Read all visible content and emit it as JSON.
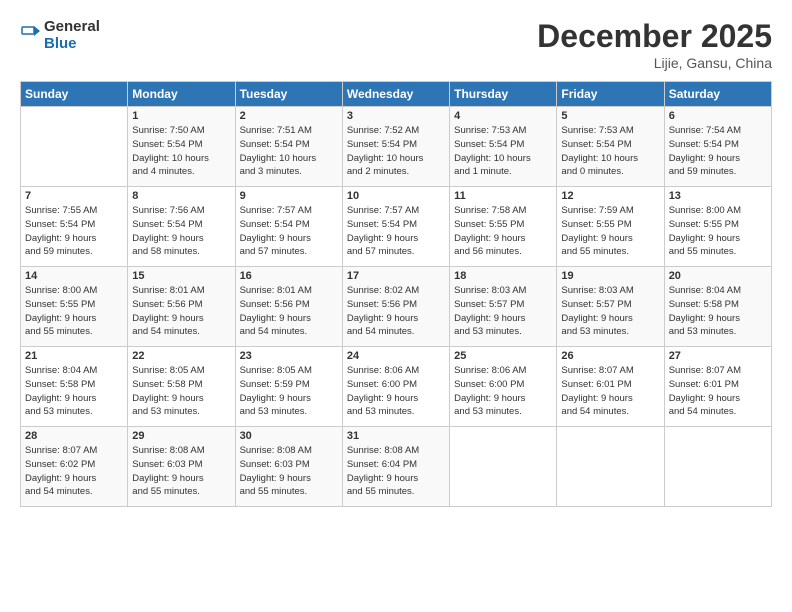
{
  "header": {
    "logo_line1": "General",
    "logo_line2": "Blue",
    "month": "December 2025",
    "location": "Lijie, Gansu, China"
  },
  "weekdays": [
    "Sunday",
    "Monday",
    "Tuesday",
    "Wednesday",
    "Thursday",
    "Friday",
    "Saturday"
  ],
  "weeks": [
    [
      {
        "day": "",
        "sunrise": "",
        "sunset": "",
        "daylight": ""
      },
      {
        "day": "1",
        "sunrise": "Sunrise: 7:50 AM",
        "sunset": "Sunset: 5:54 PM",
        "daylight": "Daylight: 10 hours and 4 minutes."
      },
      {
        "day": "2",
        "sunrise": "Sunrise: 7:51 AM",
        "sunset": "Sunset: 5:54 PM",
        "daylight": "Daylight: 10 hours and 3 minutes."
      },
      {
        "day": "3",
        "sunrise": "Sunrise: 7:52 AM",
        "sunset": "Sunset: 5:54 PM",
        "daylight": "Daylight: 10 hours and 2 minutes."
      },
      {
        "day": "4",
        "sunrise": "Sunrise: 7:53 AM",
        "sunset": "Sunset: 5:54 PM",
        "daylight": "Daylight: 10 hours and 1 minute."
      },
      {
        "day": "5",
        "sunrise": "Sunrise: 7:53 AM",
        "sunset": "Sunset: 5:54 PM",
        "daylight": "Daylight: 10 hours and 0 minutes."
      },
      {
        "day": "6",
        "sunrise": "Sunrise: 7:54 AM",
        "sunset": "Sunset: 5:54 PM",
        "daylight": "Daylight: 9 hours and 59 minutes."
      }
    ],
    [
      {
        "day": "7",
        "sunrise": "Sunrise: 7:55 AM",
        "sunset": "Sunset: 5:54 PM",
        "daylight": "Daylight: 9 hours and 59 minutes."
      },
      {
        "day": "8",
        "sunrise": "Sunrise: 7:56 AM",
        "sunset": "Sunset: 5:54 PM",
        "daylight": "Daylight: 9 hours and 58 minutes."
      },
      {
        "day": "9",
        "sunrise": "Sunrise: 7:57 AM",
        "sunset": "Sunset: 5:54 PM",
        "daylight": "Daylight: 9 hours and 57 minutes."
      },
      {
        "day": "10",
        "sunrise": "Sunrise: 7:57 AM",
        "sunset": "Sunset: 5:54 PM",
        "daylight": "Daylight: 9 hours and 57 minutes."
      },
      {
        "day": "11",
        "sunrise": "Sunrise: 7:58 AM",
        "sunset": "Sunset: 5:55 PM",
        "daylight": "Daylight: 9 hours and 56 minutes."
      },
      {
        "day": "12",
        "sunrise": "Sunrise: 7:59 AM",
        "sunset": "Sunset: 5:55 PM",
        "daylight": "Daylight: 9 hours and 55 minutes."
      },
      {
        "day": "13",
        "sunrise": "Sunrise: 8:00 AM",
        "sunset": "Sunset: 5:55 PM",
        "daylight": "Daylight: 9 hours and 55 minutes."
      }
    ],
    [
      {
        "day": "14",
        "sunrise": "Sunrise: 8:00 AM",
        "sunset": "Sunset: 5:55 PM",
        "daylight": "Daylight: 9 hours and 55 minutes."
      },
      {
        "day": "15",
        "sunrise": "Sunrise: 8:01 AM",
        "sunset": "Sunset: 5:56 PM",
        "daylight": "Daylight: 9 hours and 54 minutes."
      },
      {
        "day": "16",
        "sunrise": "Sunrise: 8:01 AM",
        "sunset": "Sunset: 5:56 PM",
        "daylight": "Daylight: 9 hours and 54 minutes."
      },
      {
        "day": "17",
        "sunrise": "Sunrise: 8:02 AM",
        "sunset": "Sunset: 5:56 PM",
        "daylight": "Daylight: 9 hours and 54 minutes."
      },
      {
        "day": "18",
        "sunrise": "Sunrise: 8:03 AM",
        "sunset": "Sunset: 5:57 PM",
        "daylight": "Daylight: 9 hours and 53 minutes."
      },
      {
        "day": "19",
        "sunrise": "Sunrise: 8:03 AM",
        "sunset": "Sunset: 5:57 PM",
        "daylight": "Daylight: 9 hours and 53 minutes."
      },
      {
        "day": "20",
        "sunrise": "Sunrise: 8:04 AM",
        "sunset": "Sunset: 5:58 PM",
        "daylight": "Daylight: 9 hours and 53 minutes."
      }
    ],
    [
      {
        "day": "21",
        "sunrise": "Sunrise: 8:04 AM",
        "sunset": "Sunset: 5:58 PM",
        "daylight": "Daylight: 9 hours and 53 minutes."
      },
      {
        "day": "22",
        "sunrise": "Sunrise: 8:05 AM",
        "sunset": "Sunset: 5:58 PM",
        "daylight": "Daylight: 9 hours and 53 minutes."
      },
      {
        "day": "23",
        "sunrise": "Sunrise: 8:05 AM",
        "sunset": "Sunset: 5:59 PM",
        "daylight": "Daylight: 9 hours and 53 minutes."
      },
      {
        "day": "24",
        "sunrise": "Sunrise: 8:06 AM",
        "sunset": "Sunset: 6:00 PM",
        "daylight": "Daylight: 9 hours and 53 minutes."
      },
      {
        "day": "25",
        "sunrise": "Sunrise: 8:06 AM",
        "sunset": "Sunset: 6:00 PM",
        "daylight": "Daylight: 9 hours and 53 minutes."
      },
      {
        "day": "26",
        "sunrise": "Sunrise: 8:07 AM",
        "sunset": "Sunset: 6:01 PM",
        "daylight": "Daylight: 9 hours and 54 minutes."
      },
      {
        "day": "27",
        "sunrise": "Sunrise: 8:07 AM",
        "sunset": "Sunset: 6:01 PM",
        "daylight": "Daylight: 9 hours and 54 minutes."
      }
    ],
    [
      {
        "day": "28",
        "sunrise": "Sunrise: 8:07 AM",
        "sunset": "Sunset: 6:02 PM",
        "daylight": "Daylight: 9 hours and 54 minutes."
      },
      {
        "day": "29",
        "sunrise": "Sunrise: 8:08 AM",
        "sunset": "Sunset: 6:03 PM",
        "daylight": "Daylight: 9 hours and 55 minutes."
      },
      {
        "day": "30",
        "sunrise": "Sunrise: 8:08 AM",
        "sunset": "Sunset: 6:03 PM",
        "daylight": "Daylight: 9 hours and 55 minutes."
      },
      {
        "day": "31",
        "sunrise": "Sunrise: 8:08 AM",
        "sunset": "Sunset: 6:04 PM",
        "daylight": "Daylight: 9 hours and 55 minutes."
      },
      {
        "day": "",
        "sunrise": "",
        "sunset": "",
        "daylight": ""
      },
      {
        "day": "",
        "sunrise": "",
        "sunset": "",
        "daylight": ""
      },
      {
        "day": "",
        "sunrise": "",
        "sunset": "",
        "daylight": ""
      }
    ]
  ]
}
